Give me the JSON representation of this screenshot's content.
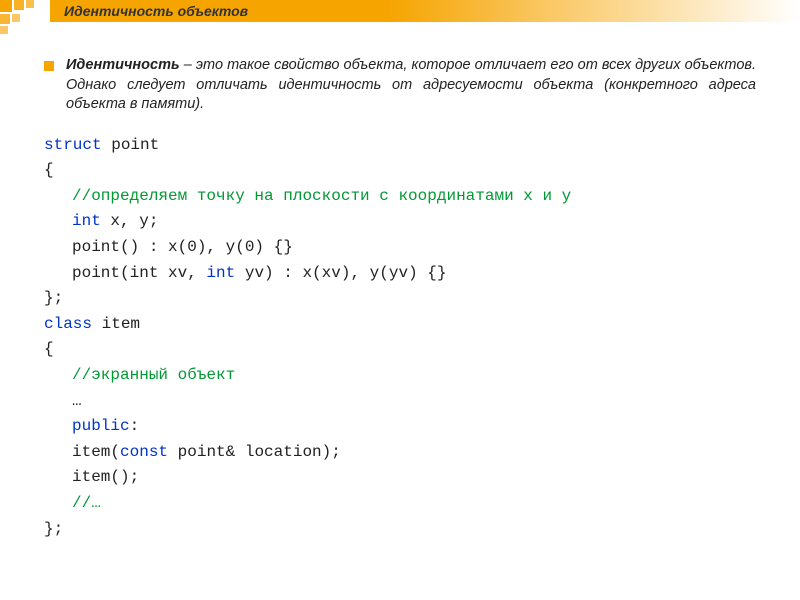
{
  "title": "Идентичность объектов",
  "paragraph": {
    "lead": "Идентичность",
    "rest": " – это такое свойство объекта, которое отличает его от всех других объектов. Однако следует отличать идентичность от адресуемости объекта (конкретного адреса объекта в памяти)."
  },
  "code": {
    "kw_struct": "struct",
    "point": " point",
    "brace_open": "{",
    "comment1": "//определяем точку на плоскости с координатами x и y",
    "kw_int": "int",
    "xy": " x, y;",
    "ctor1": "point() : x(0), y(0) {}",
    "ctor2a": "point(int xv, ",
    "ctor2b": " yv) : x(xv), y(yv) {}",
    "brace_close_semi": "};",
    "kw_class": "class",
    "item": " item",
    "comment2": "//экранный объект",
    "ellipsis": "…",
    "kw_public": "public",
    "colon": ":",
    "itemc1a": "item(",
    "kw_const": "const",
    "itemc1b": " point& location);",
    "itemc2": "item();",
    "comment3": "//…"
  }
}
